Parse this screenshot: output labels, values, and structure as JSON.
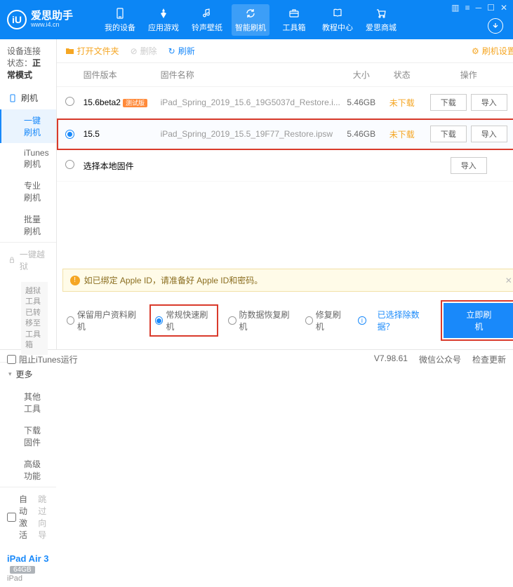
{
  "brand": {
    "cn": "爱思助手",
    "url": "www.i4.cn",
    "logo": "iU"
  },
  "nav": [
    {
      "label": "我的设备"
    },
    {
      "label": "应用游戏"
    },
    {
      "label": "铃声壁纸"
    },
    {
      "label": "智能刷机"
    },
    {
      "label": "工具箱"
    },
    {
      "label": "教程中心"
    },
    {
      "label": "爱思商城"
    }
  ],
  "status": {
    "label": "设备连接状态：",
    "value": "正常模式"
  },
  "side": {
    "flash": {
      "title": "刷机",
      "items": [
        "一键刷机",
        "iTunes刷机",
        "专业刷机",
        "批量刷机"
      ]
    },
    "jail": {
      "title": "一键越狱",
      "note": "越狱工具已转移至工具箱"
    },
    "more": {
      "title": "更多",
      "items": [
        "其他工具",
        "下载固件",
        "高级功能"
      ]
    },
    "auto": "自动激活",
    "skip": "跳过向导"
  },
  "device": {
    "name": "iPad Air 3",
    "cap": "64GB",
    "sub": "iPad"
  },
  "toolbar": {
    "open": "打开文件夹",
    "del": "删除",
    "refresh": "刷新",
    "settings": "刷机设置"
  },
  "thead": {
    "ver": "固件版本",
    "name": "固件名称",
    "size": "大小",
    "stat": "状态",
    "ops": "操作"
  },
  "rows": [
    {
      "ver": "15.6beta2",
      "badge": "测试版",
      "name": "iPad_Spring_2019_15.6_19G5037d_Restore.i...",
      "size": "5.46GB",
      "stat": "未下载",
      "selected": false
    },
    {
      "ver": "15.5",
      "badge": "",
      "name": "iPad_Spring_2019_15.5_19F77_Restore.ipsw",
      "size": "5.46GB",
      "stat": "未下载",
      "selected": true
    }
  ],
  "localRow": "选择本地固件",
  "btns": {
    "download": "下载",
    "import": "导入"
  },
  "notice": "如已绑定 Apple ID，请准备好 Apple ID和密码。",
  "opts": {
    "keep": "保留用户资料刷机",
    "fast": "常规快速刷机",
    "anti": "防数据恢复刷机",
    "repair": "修复刷机",
    "exclude": "已选择除数据？"
  },
  "primary": "立即刷机",
  "footer": {
    "block": "阻止iTunes运行",
    "ver": "V7.98.61",
    "wx": "微信公众号",
    "chk": "检查更新"
  }
}
